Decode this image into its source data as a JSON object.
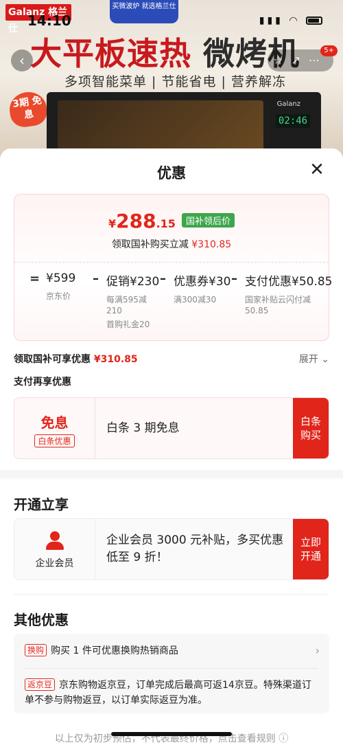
{
  "status_bar": {
    "time": "14:10",
    "signal_text": "..ıl"
  },
  "banner": {
    "brand": "Galanz 格兰仕",
    "brand_pill": "买微波炉 就选格兰仕",
    "headline_red": "大平板速热",
    "headline_dark": "微烤机",
    "subhead": "多项智能菜单 | 节能省电 | 营养解冻",
    "promo_tag": "3期 免息",
    "oven_brand": "Galanz",
    "oven_display": "02:46",
    "cart_badge": "5+"
  },
  "sheet": {
    "title": "优惠",
    "close_icon": "close-icon",
    "price": {
      "yen": "¥",
      "int": "288",
      "dec": ".15",
      "badge": "国补领后价",
      "instant_label": "领取国补购买立减",
      "instant_amount": "¥310.85"
    },
    "calc": {
      "eq": "=",
      "items": [
        {
          "value": "¥599",
          "sub": "京东价"
        },
        {
          "value": "促销¥230",
          "sub": "每满595减210",
          "sub2": "首购礼金20"
        },
        {
          "value": "优惠券¥30",
          "sub": "满300减30"
        },
        {
          "value": "支付优惠¥50.85",
          "sub": "国家补贴云闪付减50.85"
        }
      ],
      "op": "–"
    },
    "claim": {
      "label": "领取国补可享优惠",
      "amount": "¥310.85",
      "expand": "展开"
    },
    "pay_label": "支付再享优惠",
    "baitiao": {
      "title": "免息",
      "tag": "白条优惠",
      "text": "白条 3 期免息",
      "button": "白条购买"
    },
    "open_section": {
      "title": "开通立享"
    },
    "member": {
      "label": "企业会员",
      "text": "企业会员 3000 元补贴，多买优惠低至 9 折！",
      "button": "立即开通"
    },
    "other_section": {
      "title": "其他优惠"
    },
    "other_items": [
      {
        "tag": "换购",
        "text": "购买 1 件可优惠换购热销商品"
      },
      {
        "tag": "返京豆",
        "text": "京东购物返京豆，订单完成后最高可返14京豆。特殊渠道订单不参与购物返豆，以订单实际返豆为准。"
      }
    ],
    "footer": "以上仅为初步预估，不代表最终价格，点击查看规则 ⓘ"
  },
  "colors": {
    "accent": "#e1251b",
    "green_badge": "#3ea64c"
  }
}
